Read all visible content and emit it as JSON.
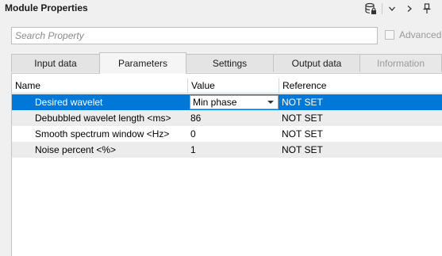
{
  "window": {
    "title": "Module Properties",
    "toolbar_icons": [
      "database-lock-icon",
      "chevron-down-icon",
      "chevron-right-icon",
      "pin-icon"
    ]
  },
  "search": {
    "placeholder": "Search Property",
    "value": "",
    "advanced_label": "Advanced",
    "advanced_checked": false
  },
  "tabs": [
    {
      "label": "Input data",
      "active": false,
      "enabled": true
    },
    {
      "label": "Parameters",
      "active": true,
      "enabled": true
    },
    {
      "label": "Settings",
      "active": false,
      "enabled": true
    },
    {
      "label": "Output data",
      "active": false,
      "enabled": true
    },
    {
      "label": "Information",
      "active": false,
      "enabled": false
    }
  ],
  "grid": {
    "columns": [
      "Name",
      "Value",
      "Reference"
    ],
    "rows": [
      {
        "name": "Desired wavelet",
        "value": "Min phase",
        "reference": "NOT SET",
        "selected": true,
        "editor": "dropdown"
      },
      {
        "name": "Debubbled wavelet length <ms>",
        "value": "86",
        "reference": "NOT SET",
        "selected": false
      },
      {
        "name": "Smooth spectrum window <Hz>",
        "value": "0",
        "reference": "NOT SET",
        "selected": false
      },
      {
        "name": "Noise percent <%>",
        "value": "1",
        "reference": "NOT SET",
        "selected": false
      }
    ]
  },
  "colors": {
    "selection": "#0078d7",
    "alt_row": "#ececec",
    "background": "#f0f0f0"
  }
}
